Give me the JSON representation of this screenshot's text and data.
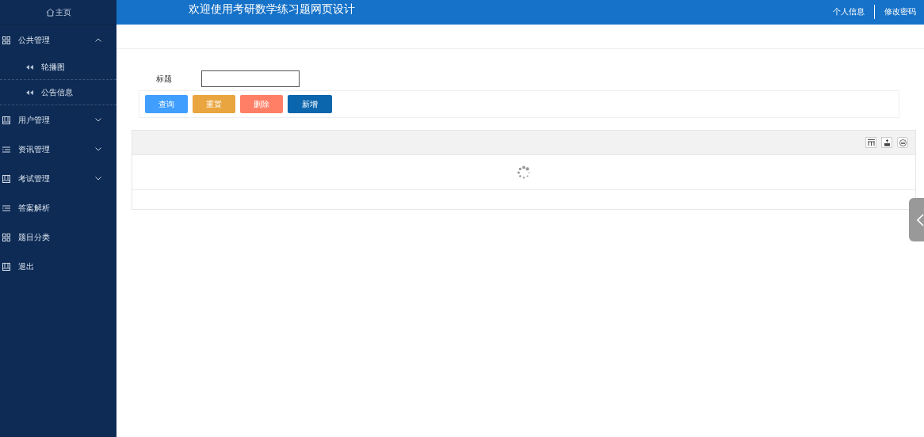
{
  "sidebar": {
    "home": "主页",
    "menu": [
      {
        "label": "公共管理",
        "kind": "grid",
        "expanded": true,
        "children": [
          {
            "label": "轮播图"
          },
          {
            "label": "公告信息"
          }
        ]
      },
      {
        "label": "用户管理",
        "kind": "book",
        "expanded": false
      },
      {
        "label": "资讯管理",
        "kind": "list",
        "expanded": false
      },
      {
        "label": "考试管理",
        "kind": "book",
        "expanded": false
      },
      {
        "label": "答案解析",
        "kind": "list"
      },
      {
        "label": "题目分类",
        "kind": "grid"
      },
      {
        "label": "退出",
        "kind": "book"
      }
    ]
  },
  "header": {
    "title": "欢迎使用考研数学练习题网页设计",
    "links": [
      "个人信息",
      "修改密码"
    ]
  },
  "search": {
    "label": "标题",
    "buttons": [
      {
        "label": "查询",
        "kind": "query"
      },
      {
        "label": "重置",
        "kind": "reset"
      },
      {
        "label": "删除",
        "kind": "delete"
      },
      {
        "label": "新增",
        "kind": "add"
      }
    ]
  },
  "table": {
    "loading": true
  }
}
